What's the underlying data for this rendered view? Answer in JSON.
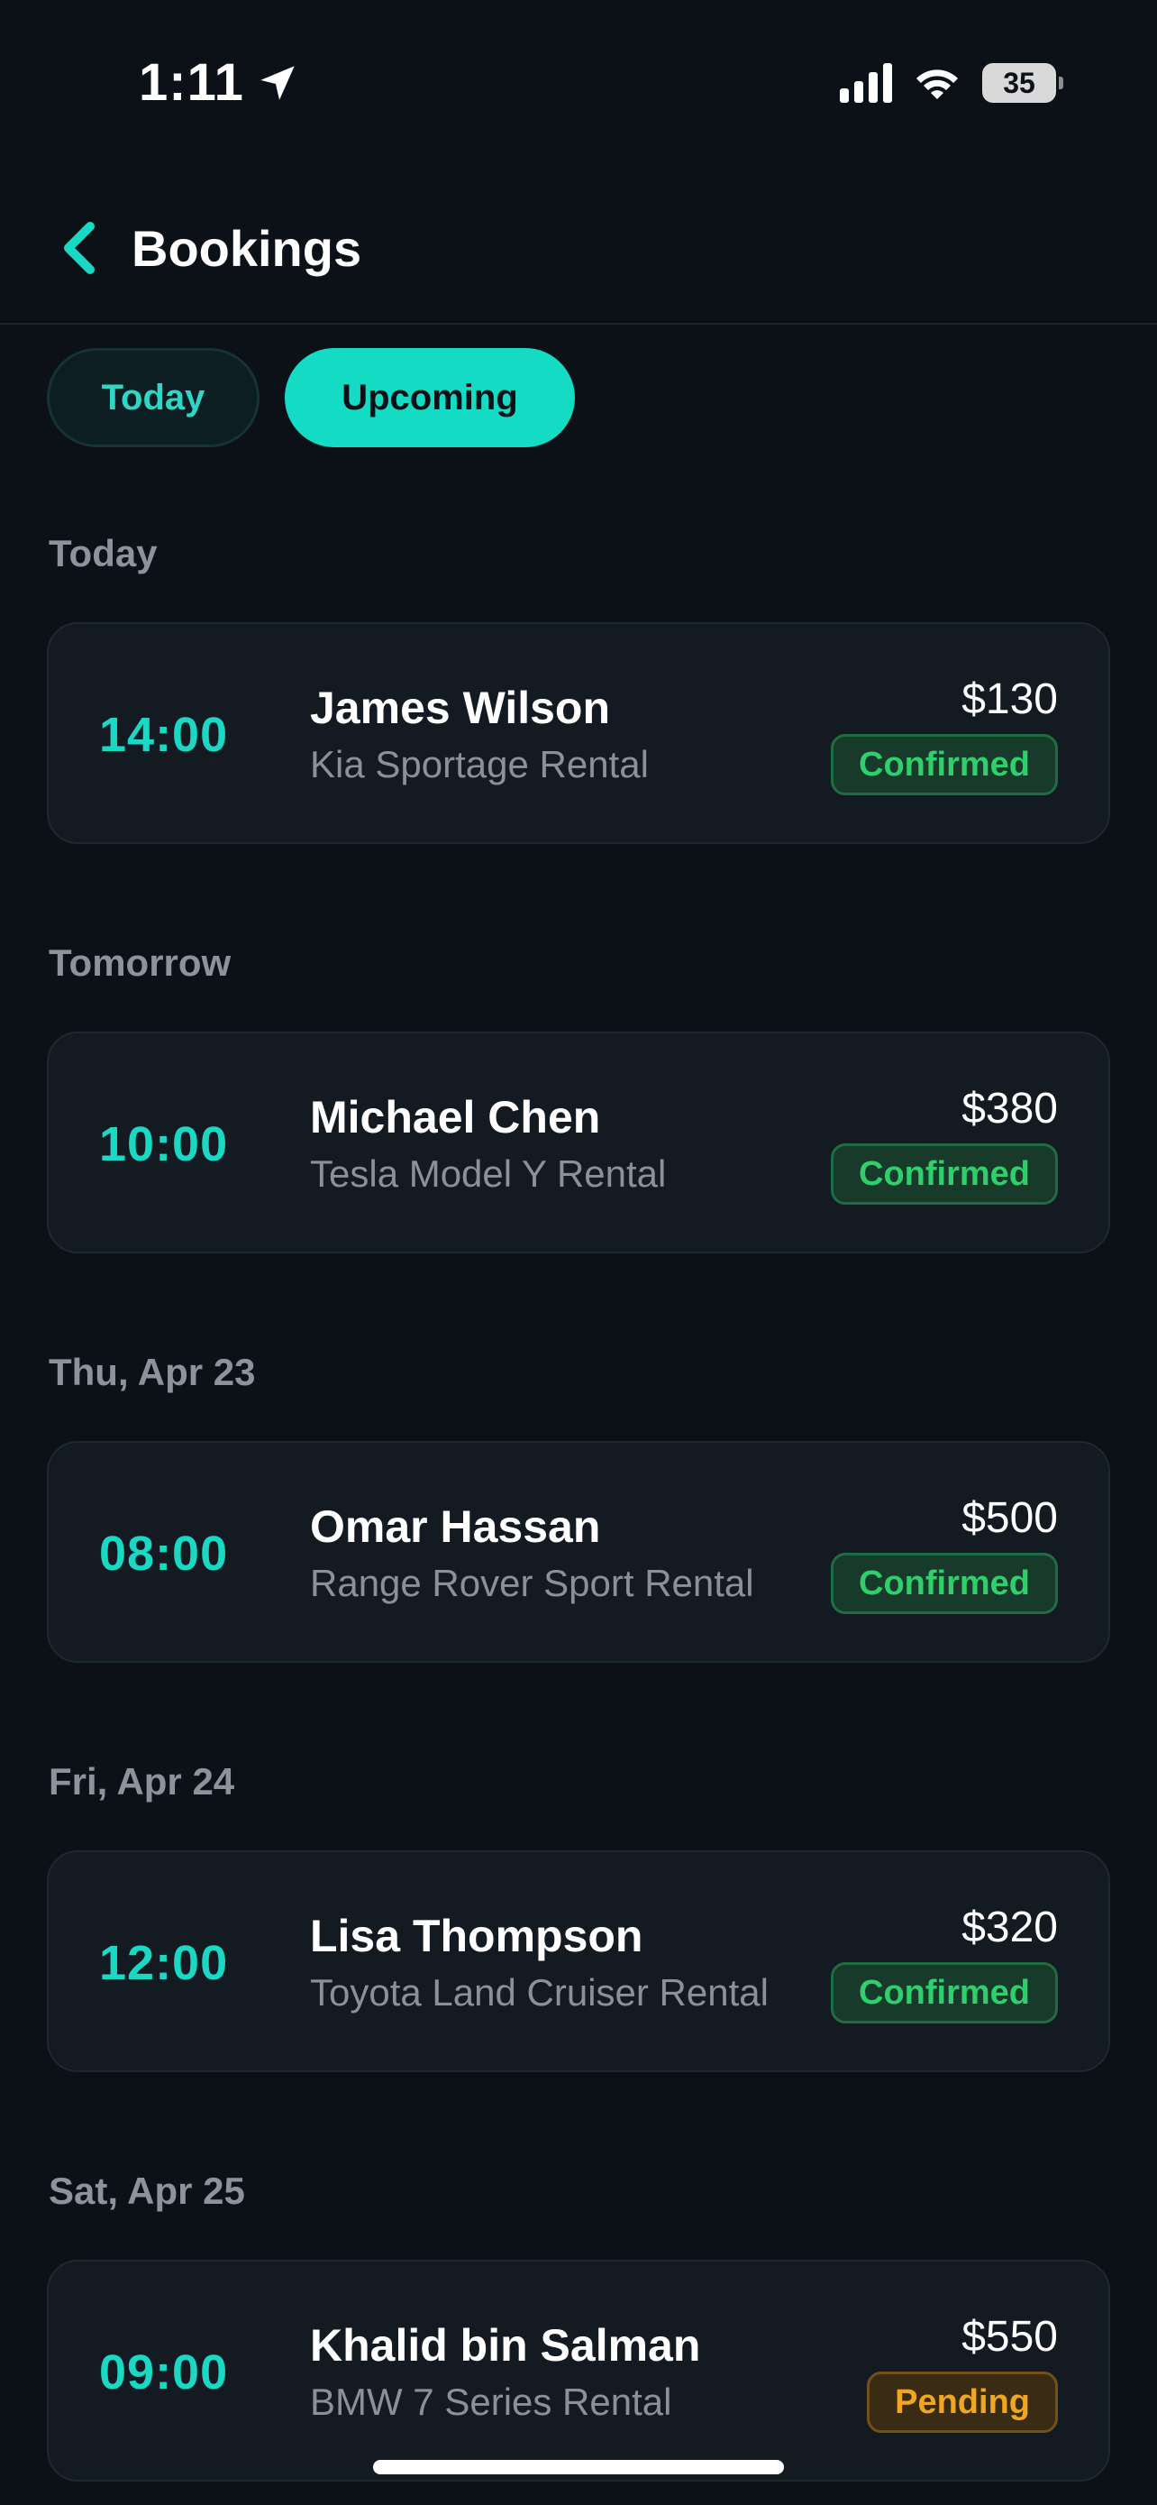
{
  "status_bar": {
    "time": "1:11",
    "battery": "35",
    "icons": [
      "location-arrow-icon",
      "cellular-signal-icon",
      "wifi-icon",
      "battery-icon"
    ]
  },
  "header": {
    "title": "Bookings",
    "back_icon": "chevron-left-icon"
  },
  "tabs": [
    {
      "label": "Today",
      "active": false
    },
    {
      "label": "Upcoming",
      "active": true
    }
  ],
  "sections": [
    {
      "label": "Today",
      "booking": {
        "time": "14:00",
        "name": "James Wilson",
        "vehicle": "Kia Sportage Rental",
        "price": "$130",
        "status": "Confirmed"
      }
    },
    {
      "label": "Tomorrow",
      "booking": {
        "time": "10:00",
        "name": "Michael Chen",
        "vehicle": "Tesla Model Y Rental",
        "price": "$380",
        "status": "Confirmed"
      }
    },
    {
      "label": "Thu, Apr 23",
      "booking": {
        "time": "08:00",
        "name": "Omar Hassan",
        "vehicle": "Range Rover Sport Rental",
        "price": "$500",
        "status": "Confirmed"
      }
    },
    {
      "label": "Fri, Apr 24",
      "booking": {
        "time": "12:00",
        "name": "Lisa Thompson",
        "vehicle": "Toyota Land Cruiser Rental",
        "price": "$320",
        "status": "Confirmed"
      }
    },
    {
      "label": "Sat, Apr 25",
      "booking": {
        "time": "09:00",
        "name": "Khalid bin Salman",
        "vehicle": "BMW 7 Series Rental",
        "price": "$550",
        "status": "Pending"
      }
    }
  ],
  "colors": {
    "background": "#0c1017",
    "accent": "#14dcc4",
    "confirmed": "#2fcf6b",
    "pending": "#f0a623"
  }
}
